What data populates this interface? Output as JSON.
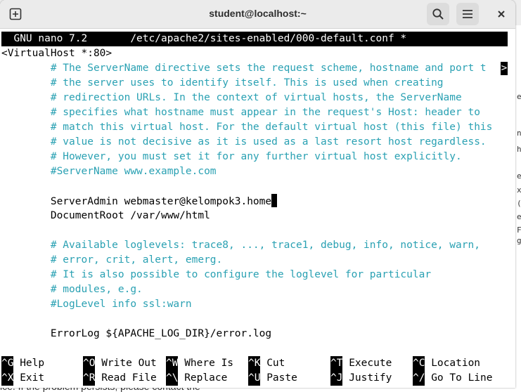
{
  "window": {
    "title": "student@localhost:~"
  },
  "nano": {
    "header": "  GNU nano 7.2       /etc/apache2/sites-enabled/000-default.conf *",
    "lines": [
      {
        "text": "<VirtualHost *:80>",
        "type": "code"
      },
      {
        "text": "        # The ServerName directive sets the request scheme, hostname and port t",
        "type": "comment"
      },
      {
        "text": "        # the server uses to identify itself. This is used when creating",
        "type": "comment"
      },
      {
        "text": "        # redirection URLs. In the context of virtual hosts, the ServerName",
        "type": "comment"
      },
      {
        "text": "        # specifies what hostname must appear in the request's Host: header to",
        "type": "comment"
      },
      {
        "text": "        # match this virtual host. For the default virtual host (this file) this",
        "type": "comment"
      },
      {
        "text": "        # value is not decisive as it is used as a last resort host regardless.",
        "type": "comment"
      },
      {
        "text": "        # However, you must set it for any further virtual host explicitly.",
        "type": "comment"
      },
      {
        "text": "        #ServerName www.example.com",
        "type": "comment"
      },
      {
        "text": "",
        "type": "code"
      },
      {
        "text": "        ServerAdmin webmaster@kelompok3.home",
        "type": "code"
      },
      {
        "text": "        DocumentRoot /var/www/html",
        "type": "code"
      },
      {
        "text": "",
        "type": "code"
      },
      {
        "text": "        # Available loglevels: trace8, ..., trace1, debug, info, notice, warn,",
        "type": "comment"
      },
      {
        "text": "        # error, crit, alert, emerg.",
        "type": "comment"
      },
      {
        "text": "        # It is also possible to configure the loglevel for particular",
        "type": "comment"
      },
      {
        "text": "        # modules, e.g.",
        "type": "comment"
      },
      {
        "text": "        #LogLevel info ssl:warn",
        "type": "comment"
      },
      {
        "text": "",
        "type": "code"
      },
      {
        "text": "        ErrorLog ${APACHE_LOG_DIR}/error.log",
        "type": "code"
      }
    ],
    "overflow_marker": ">",
    "shortcuts": [
      [
        {
          "key": "^G",
          "label": "Help"
        },
        {
          "key": "^O",
          "label": "Write Out"
        },
        {
          "key": "^W",
          "label": "Where Is"
        },
        {
          "key": "^K",
          "label": "Cut"
        },
        {
          "key": "^T",
          "label": "Execute"
        },
        {
          "key": "^C",
          "label": "Location"
        }
      ],
      [
        {
          "key": "^X",
          "label": "Exit"
        },
        {
          "key": "^R",
          "label": "Read File"
        },
        {
          "key": "^\\",
          "label": "Replace"
        },
        {
          "key": "^U",
          "label": "Paste"
        },
        {
          "key": "^J",
          "label": "Justify"
        },
        {
          "key": "^/",
          "label": "Go To Line"
        }
      ]
    ]
  },
  "background": {
    "bottom_text": "ice. If the problem persists, please contact the",
    "right_chars": [
      "e",
      "n",
      "h",
      "e",
      "x",
      "(",
      "e",
      "F",
      "g"
    ]
  },
  "colors": {
    "comment": "#2aa1b3",
    "header_bg": "#000000",
    "titlebar_bg": "#ebebeb"
  },
  "icons": {
    "new_tab": "new-tab-icon",
    "search": "search-icon",
    "menu": "hamburger-menu-icon",
    "close": "close-icon"
  }
}
